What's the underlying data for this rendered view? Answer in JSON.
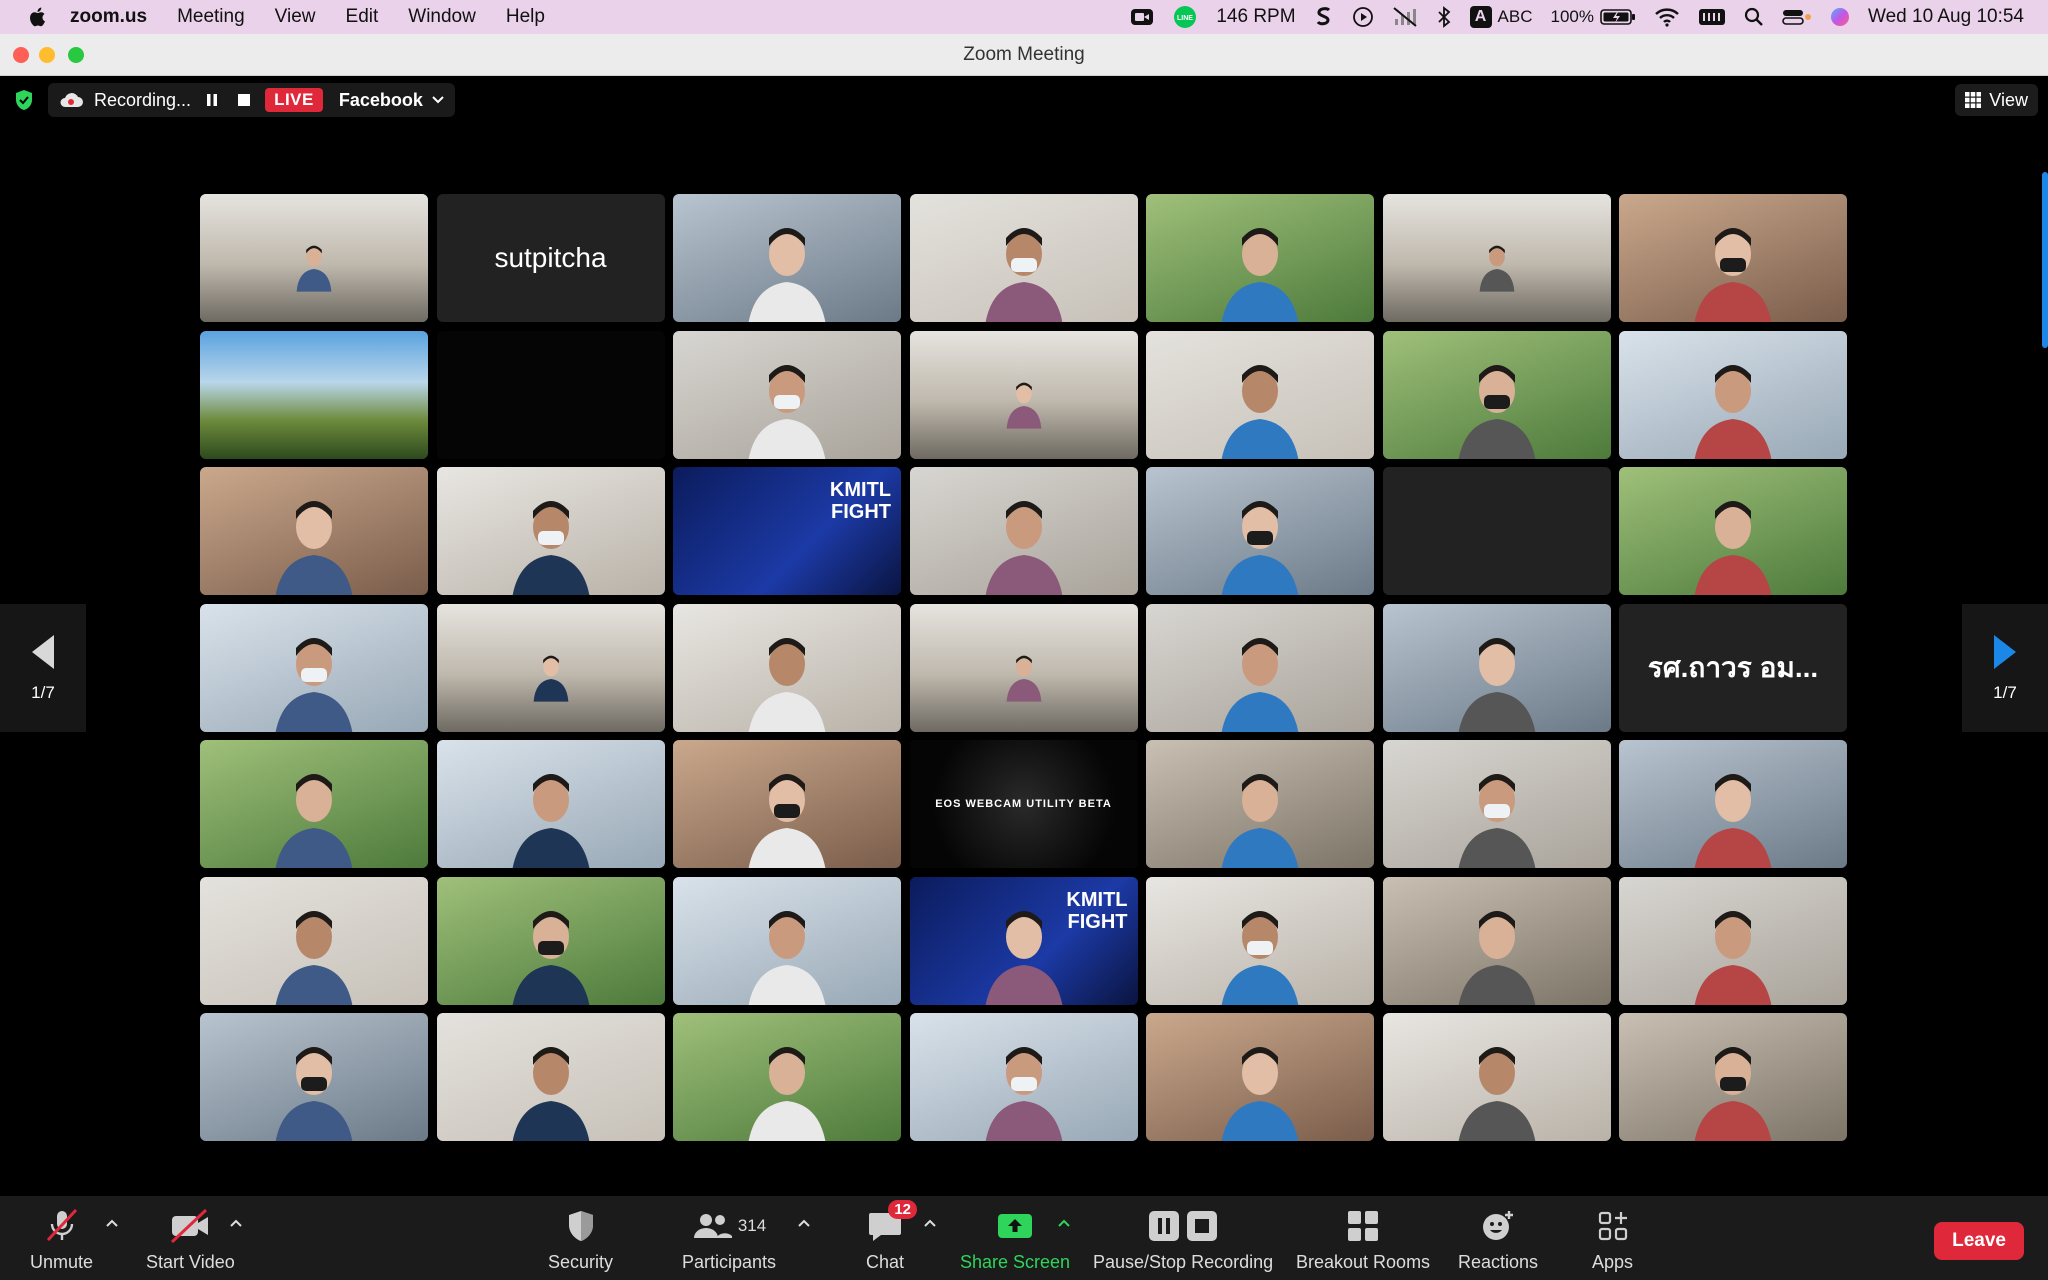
{
  "menubar": {
    "app_name": "zoom.us",
    "menus": [
      "Meeting",
      "View",
      "Edit",
      "Window",
      "Help"
    ],
    "rpm_value": "146",
    "rpm_unit": "RPM",
    "input_source": "ABC",
    "input_letter": "A",
    "battery": "100%",
    "datetime": "Wed 10 Aug  10:54",
    "line_icon_text": "LINE"
  },
  "window": {
    "title": "Zoom Meeting"
  },
  "topbar": {
    "recording_label": "Recording...",
    "live_label": "LIVE",
    "stream_target": "Facebook",
    "view_label": "View"
  },
  "gallery": {
    "page_left": "1/7",
    "page_right": "1/7",
    "tiles": [
      {
        "kind": "room",
        "active": true
      },
      {
        "kind": "name",
        "name": "sutpitcha"
      },
      {
        "kind": "person"
      },
      {
        "kind": "person"
      },
      {
        "kind": "person"
      },
      {
        "kind": "room"
      },
      {
        "kind": "person"
      },
      {
        "kind": "image"
      },
      {
        "kind": "blank"
      },
      {
        "kind": "person"
      },
      {
        "kind": "room"
      },
      {
        "kind": "person"
      },
      {
        "kind": "person"
      },
      {
        "kind": "person"
      },
      {
        "kind": "person"
      },
      {
        "kind": "person"
      },
      {
        "kind": "image",
        "banner": "KMITL FIGHT"
      },
      {
        "kind": "person"
      },
      {
        "kind": "person"
      },
      {
        "kind": "blank"
      },
      {
        "kind": "person"
      },
      {
        "kind": "person"
      },
      {
        "kind": "room"
      },
      {
        "kind": "person"
      },
      {
        "kind": "room"
      },
      {
        "kind": "person"
      },
      {
        "kind": "person"
      },
      {
        "kind": "name",
        "name": "รศ.ถาวร อม...",
        "bold": true
      },
      {
        "kind": "person"
      },
      {
        "kind": "person"
      },
      {
        "kind": "person"
      },
      {
        "kind": "image",
        "banner": "EOS WEBCAM UTILITY BETA"
      },
      {
        "kind": "person"
      },
      {
        "kind": "person"
      },
      {
        "kind": "person"
      },
      {
        "kind": "person"
      },
      {
        "kind": "person"
      },
      {
        "kind": "person"
      },
      {
        "kind": "person",
        "banner": "KMITL FIGHT"
      },
      {
        "kind": "person"
      },
      {
        "kind": "person"
      },
      {
        "kind": "person"
      },
      {
        "kind": "person"
      },
      {
        "kind": "person"
      },
      {
        "kind": "person"
      },
      {
        "kind": "person"
      },
      {
        "kind": "person"
      },
      {
        "kind": "person"
      },
      {
        "kind": "person"
      }
    ]
  },
  "toolbar": {
    "unmute": "Unmute",
    "start_video": "Start Video",
    "security": "Security",
    "participants": "Participants",
    "participants_count": "314",
    "chat": "Chat",
    "chat_badge": "12",
    "share_screen": "Share Screen",
    "pause_stop_recording": "Pause/Stop Recording",
    "breakout_rooms": "Breakout Rooms",
    "reactions": "Reactions",
    "apps": "Apps",
    "leave": "Leave"
  },
  "colors": {
    "live_red": "#e0283b",
    "active_green": "#2fd45a",
    "share_green": "#2fd45a",
    "accent_blue": "#1b87e6",
    "menubar_bg": "#ead3ea"
  }
}
